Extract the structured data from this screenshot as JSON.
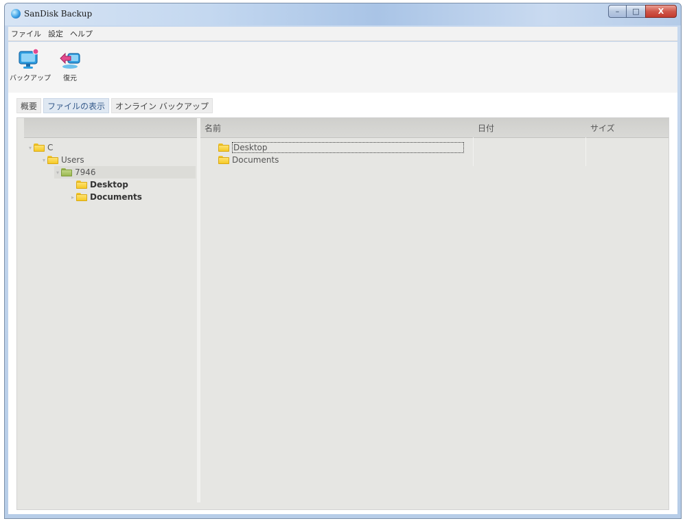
{
  "window": {
    "title": "SanDisk Backup",
    "caption_buttons": {
      "minimize": "–",
      "maximize": "□",
      "close": "X"
    }
  },
  "menu": [
    "ファイル",
    "設定",
    "ヘルプ"
  ],
  "toolbar": {
    "backup_label": "バックアップ",
    "restore_label": "復元"
  },
  "tabs": [
    {
      "label": "概要",
      "active": false
    },
    {
      "label": "ファイルの表示",
      "active": true
    },
    {
      "label": "オンライン バックアップ",
      "active": false
    }
  ],
  "tree": {
    "nodes": [
      {
        "label": "C",
        "expander": "▾"
      },
      {
        "label": "Users",
        "expander": "▾"
      },
      {
        "label": "7946",
        "expander": "▾",
        "selected": true
      },
      {
        "label": "Desktop",
        "expander": ""
      },
      {
        "label": "Documents",
        "expander": "▸"
      }
    ]
  },
  "file_list": {
    "columns": [
      "名前",
      "日付",
      "サイズ"
    ],
    "rows": [
      {
        "name": "Desktop",
        "focused": true
      },
      {
        "name": "Documents",
        "focused": false
      }
    ]
  },
  "colors": {
    "titlebar": "#c4d8f0",
    "panel_bg": "#e6e6e3",
    "active_tab_text": "#355a8a",
    "folder": "#f5c61d",
    "user_folder": "#96b54a",
    "close_button": "#c23b2e"
  }
}
